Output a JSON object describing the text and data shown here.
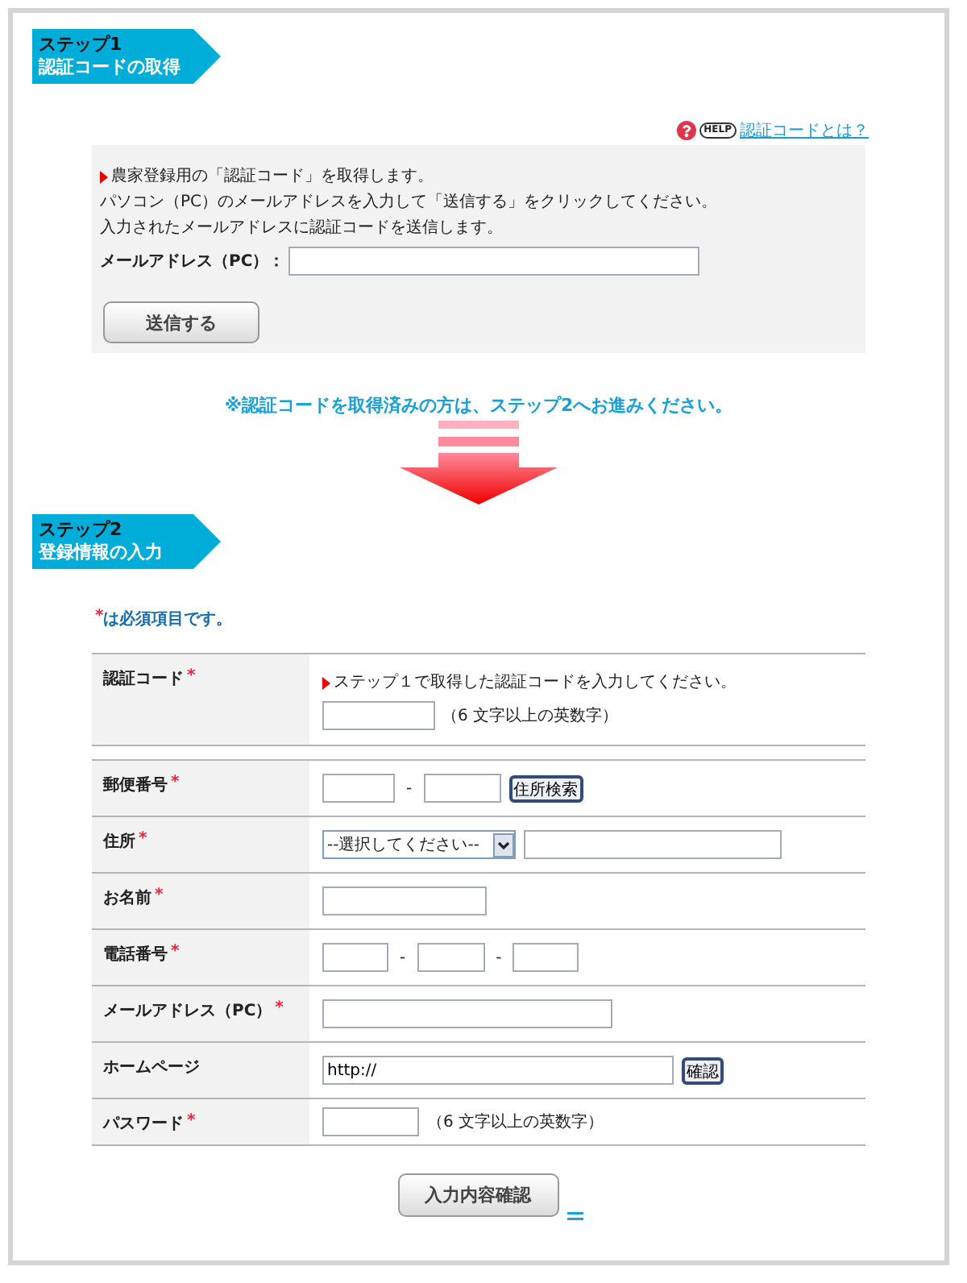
{
  "step1": {
    "label": "ステップ1",
    "title": "認証コードの取得"
  },
  "help": {
    "badge": "HELP",
    "link": "認証コードとは？"
  },
  "request_panel": {
    "lines": [
      "農家登録用の「認証コード」を取得します。",
      "パソコン（PC）のメールアドレスを入力して「送信する」をクリックしてください。",
      "入力されたメールアドレスに認証コードを送信します。"
    ],
    "email_label": "メールアドレス（PC）：",
    "send_button": "送信する"
  },
  "notice": "※認証コードを取得済みの方は、ステップ2へお進みください。",
  "step2": {
    "label": "ステップ2",
    "title": "登録情報の入力"
  },
  "required_note": {
    "mark": "*",
    "text": "は必須項目です。"
  },
  "form": {
    "sections": [
      {
        "rows": [
          {
            "kind": "code",
            "label": "認証コード",
            "required_mark": "*",
            "hint": "ステップ１で取得した認証コードを入力してください。",
            "note": "（6 文字以上の英数字）"
          }
        ]
      },
      {
        "rows": [
          {
            "kind": "postal",
            "label": "郵便番号",
            "required_mark": "*",
            "separator": "-",
            "button": "住所検索"
          },
          {
            "kind": "address",
            "label": "住所",
            "required_mark": "*",
            "select": "--選択してください--"
          },
          {
            "kind": "text",
            "label": "お名前",
            "required_mark": "*"
          },
          {
            "kind": "phone",
            "label": "電話番号",
            "required_mark": "*",
            "separators": [
              "-",
              "-"
            ]
          },
          {
            "kind": "email",
            "label": "メールアドレス（PC）",
            "required_mark": "*"
          },
          {
            "kind": "url",
            "label": "ホームページ",
            "value": "http://",
            "button": "確認"
          },
          {
            "kind": "password",
            "label": "パスワード",
            "required_mark": "*",
            "note": "（6 文字以上の英数字）"
          }
        ]
      }
    ]
  },
  "confirm_button": "入力内容確認"
}
